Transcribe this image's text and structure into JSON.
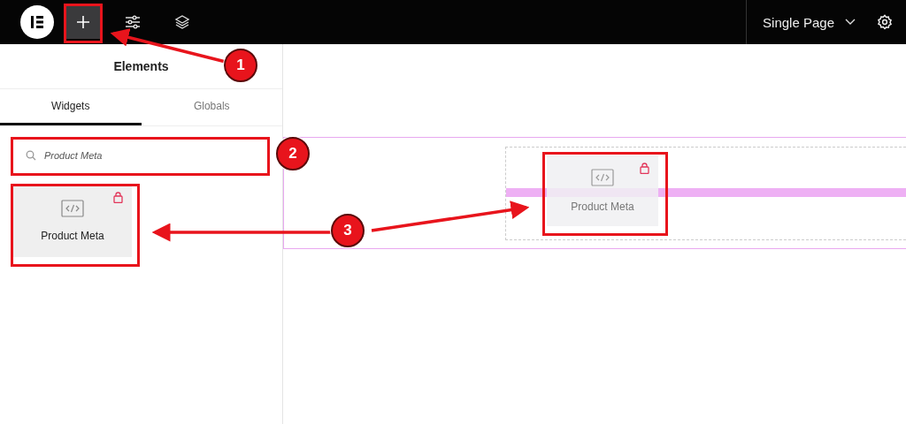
{
  "topbar": {
    "tools": [
      {
        "kind": "add",
        "selected": true
      },
      {
        "kind": "sliders",
        "selected": false
      },
      {
        "kind": "layers",
        "selected": false
      }
    ],
    "document": "Single Page"
  },
  "panel": {
    "title": "Elements",
    "tabs": [
      {
        "label": "Widgets",
        "selected": true
      },
      {
        "label": "Globals",
        "selected": false
      }
    ],
    "search": {
      "value": "Product Meta"
    },
    "widgets": [
      {
        "label": "Product Meta",
        "locked": true
      }
    ]
  },
  "canvas": {
    "dragged": {
      "label": "Product Meta",
      "locked": true
    }
  },
  "callouts": [
    {
      "number": "1"
    },
    {
      "number": "2"
    },
    {
      "number": "3"
    }
  ]
}
